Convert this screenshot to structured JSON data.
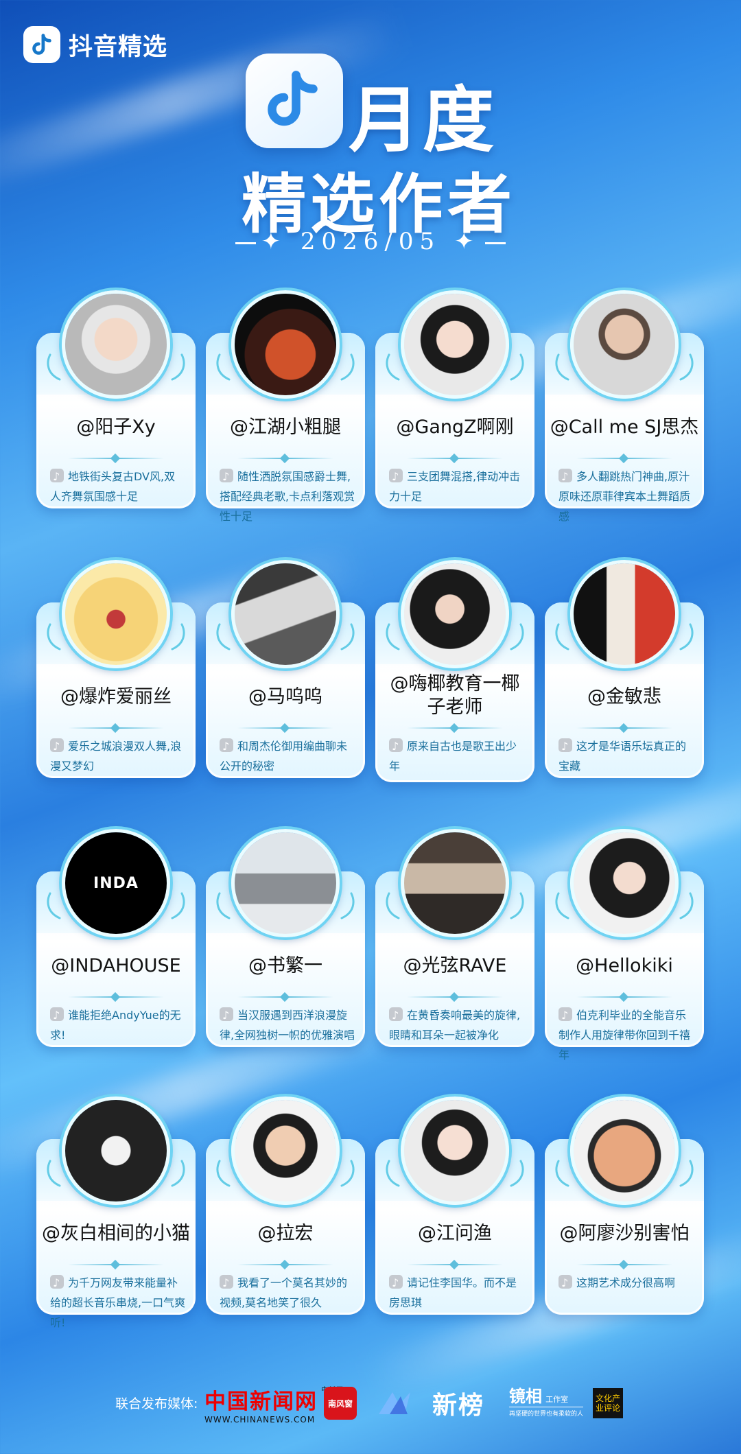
{
  "brand": {
    "name": "抖音精选"
  },
  "title": {
    "line1": "月度",
    "line2": "精选作者",
    "date": "2026/05"
  },
  "authors": [
    {
      "name": "@阳子Xy",
      "desc": "地铁街头复古DV风,双人齐舞氛围感十足"
    },
    {
      "name": "@江湖小粗腿",
      "desc": "随性洒脱氛围感爵士舞,搭配经典老歌,卡点利落观赏性十足"
    },
    {
      "name": "@GangZ啊刚",
      "desc": "三支团舞混搭,律动冲击力十足"
    },
    {
      "name": "@Call me SJ思杰",
      "desc": "多人翻跳热门神曲,原汁原味还原菲律宾本土舞蹈质感"
    },
    {
      "name": "@爆炸爱丽丝",
      "desc": "爱乐之城浪漫双人舞,浪漫又梦幻"
    },
    {
      "name": "@马呜呜",
      "desc": "和周杰伦御用编曲聊未公开的秘密"
    },
    {
      "name": "@嗨椰教育一椰子老师",
      "desc": "原来自古也是歌王出少年"
    },
    {
      "name": "@金敏悲",
      "desc": "这才是华语乐坛真正的宝藏"
    },
    {
      "name": "@INDAHOUSE",
      "desc": "谁能拒绝AndyYue的无求!"
    },
    {
      "name": "@书繁一",
      "desc": "当汉服遇到西洋浪漫旋律,全网独树一帜的优雅演唱"
    },
    {
      "name": "@光弦RAVE",
      "desc": "在黄昏奏响最美的旋律,眼睛和耳朵一起被净化"
    },
    {
      "name": "@Hellokiki",
      "desc": "伯克利毕业的全能音乐制作人用旋律带你回到千禧年"
    },
    {
      "name": "@灰白相间的小猫",
      "desc": "为千万网友带来能量补给的超长音乐串烧,一口气爽听!"
    },
    {
      "name": "@拉宏",
      "desc": "我看了一个莫名其妙的视频,莫名地笑了很久"
    },
    {
      "name": "@江问渔",
      "desc": "请记住李国华。而不是房思琪"
    },
    {
      "name": "@阿廖沙别害怕",
      "desc": "这期艺术成分很高啊"
    }
  ],
  "footer": {
    "label": "联合发布媒体:",
    "media1_main": "中国新闻网",
    "media1_side": "中新网",
    "media1_url": "WWW.CHINANEWS.COM",
    "media2": "南风窗",
    "media3": "新榜",
    "media4_main": "镜相",
    "media4_sub": "工作室",
    "media4_tag": "再坚硬的世界也有柔软的人",
    "media5": "文化产业评论"
  }
}
